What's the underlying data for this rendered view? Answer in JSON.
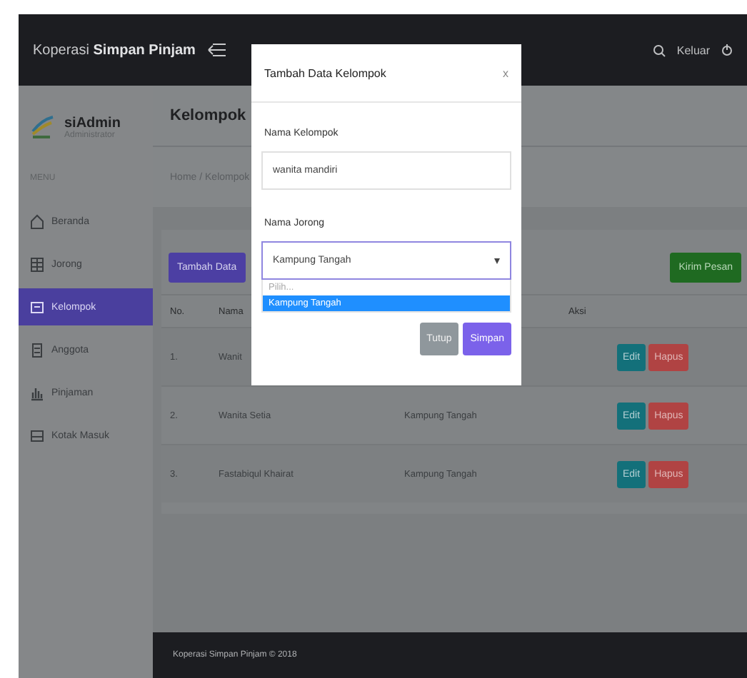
{
  "header": {
    "brand": "Koperasi **Simpan Pinjam**",
    "logout": "Keluar"
  },
  "sidebar": {
    "user": "siAdmin",
    "role": "Administrator",
    "section": "MENU",
    "items": [
      {
        "label": "Beranda",
        "selected": false
      },
      {
        "label": "Jorong",
        "selected": false
      },
      {
        "label": "Kelompok",
        "selected": true
      },
      {
        "label": "Anggota",
        "selected": false
      },
      {
        "label": "Pinjaman",
        "selected": false
      },
      {
        "label": "Kotak Masuk",
        "selected": false
      }
    ]
  },
  "page": {
    "title": "Kelompok",
    "breadcrumb": "Home / Kelompok",
    "add_button": "Tambah Data",
    "message_button": "Kirim Pesan"
  },
  "table": {
    "columns": [
      {
        "kind": "text",
        "label": "No."
      },
      {
        "kind": "text",
        "label": "Nama"
      },
      {
        "kind": "hidden"
      },
      {
        "kind": "text",
        "label": "Aksi"
      }
    ],
    "rows": [
      {
        "no": "1.",
        "name": "Wanit",
        "column_3": null,
        "actions": [
          "Edit",
          "Hapus"
        ]
      },
      {
        "no": "2.",
        "name": "Wanita Setia",
        "column_3": "Kampung Tangah",
        "actions": [
          "Edit",
          "Hapus"
        ]
      },
      {
        "no": "3.",
        "name": "Fastabiqul Khairat",
        "column_3": "Kampung Tangah",
        "actions": [
          "Edit",
          "Hapus"
        ]
      }
    ]
  },
  "footer": "Koperasi Simpan Pinjam © 2018",
  "modal": {
    "title": "Tambah Data Kelompok",
    "close": "x",
    "fields": [
      {
        "kind": "input",
        "label": "Nama Kelompok",
        "value": "wanita mandiri"
      },
      {
        "kind": "select",
        "label": "Nama Jorong",
        "value": "Kampung Tangah",
        "options": [
          {
            "label": "Pilih...",
            "selected": false
          },
          {
            "label": "Kampung Tangah",
            "selected": true
          }
        ]
      }
    ],
    "buttons": [
      {
        "kind": "secondary",
        "label": "Tutup"
      },
      {
        "kind": "primary",
        "label": "Simpan"
      }
    ]
  }
}
